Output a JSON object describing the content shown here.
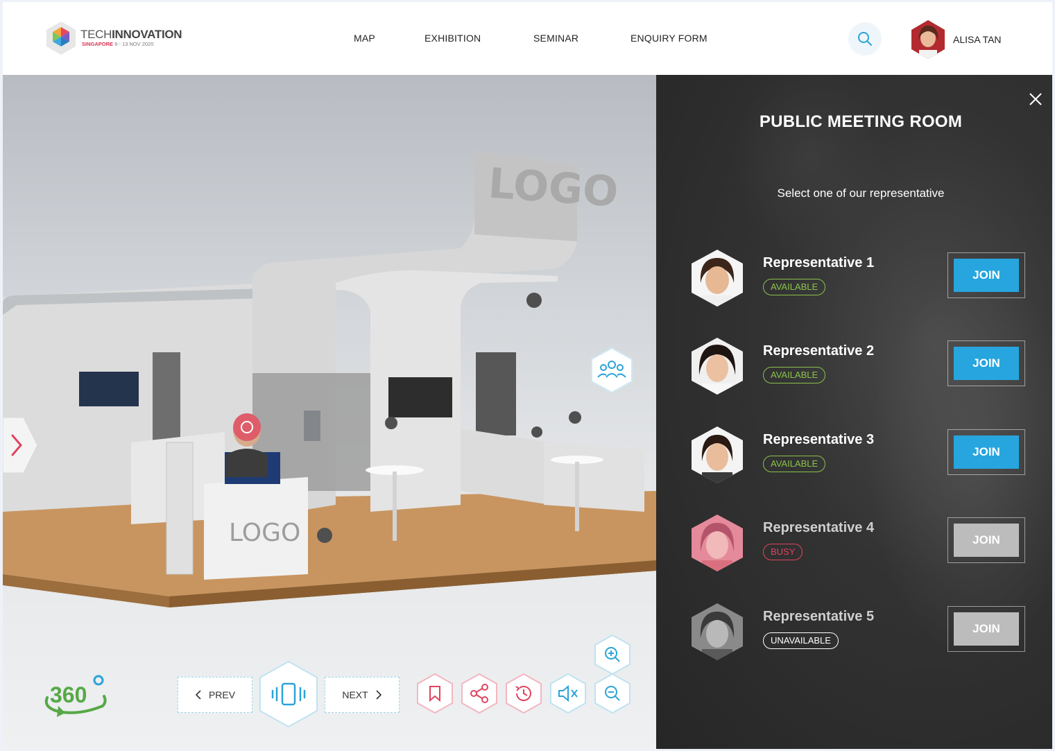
{
  "brand": {
    "name_light": "TECH",
    "name_bold": "INNOVATION",
    "location": "SINGAPORE",
    "dates": "9 - 13 NOV 2020"
  },
  "nav": [
    {
      "label": "MAP"
    },
    {
      "label": "EXHIBITION"
    },
    {
      "label": "SEMINAR"
    },
    {
      "label": "ENQUIRY FORM"
    }
  ],
  "user": {
    "name": "ALISA TAN"
  },
  "booth": {
    "sign_top": "LOGO",
    "sign_desk": "LOGO"
  },
  "controls": {
    "prev_label": "PREV",
    "next_label": "NEXT",
    "view_label": "360"
  },
  "panel": {
    "title": "PUBLIC MEETING ROOM",
    "subtitle": "Select one of our representative",
    "representatives": [
      {
        "name": "Representative 1",
        "status": "AVAILABLE",
        "join_label": "JOIN"
      },
      {
        "name": "Representative 2",
        "status": "AVAILABLE",
        "join_label": "JOIN"
      },
      {
        "name": "Representative 3",
        "status": "AVAILABLE",
        "join_label": "JOIN"
      },
      {
        "name": "Representative 4",
        "status": "BUSY",
        "join_label": "JOIN"
      },
      {
        "name": "Representative 5",
        "status": "UNAVAILABLE",
        "join_label": "JOIN"
      }
    ]
  },
  "colors": {
    "accent": "#27a5de",
    "available": "#8bc34a",
    "busy": "#e0435e",
    "disabled": "#bcbcbc",
    "hotspot": "#e0435e"
  }
}
